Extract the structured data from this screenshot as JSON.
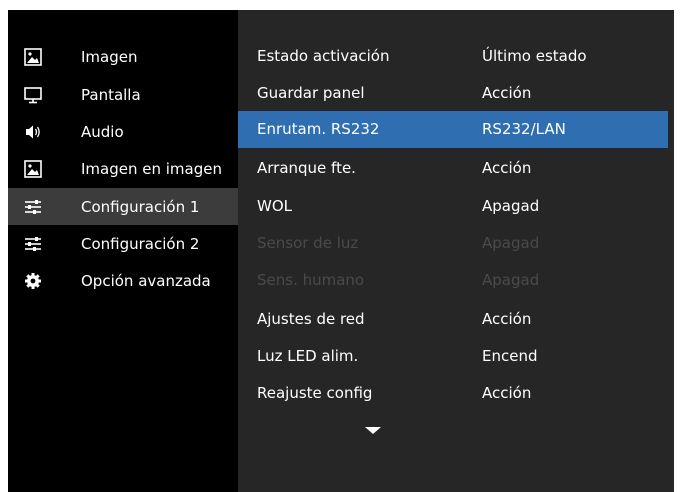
{
  "sidebar": {
    "items": [
      {
        "label": "Imagen",
        "icon": "picture-icon"
      },
      {
        "label": "Pantalla",
        "icon": "monitor-icon"
      },
      {
        "label": "Audio",
        "icon": "speaker-icon"
      },
      {
        "label": "Imagen en imagen",
        "icon": "picture-in-picture-icon"
      },
      {
        "label": "Configuración 1",
        "icon": "sliders-icon"
      },
      {
        "label": "Configuración 2",
        "icon": "sliders-icon"
      },
      {
        "label": "Opción avanzada",
        "icon": "gear-icon"
      }
    ],
    "active_index": 4
  },
  "settings": {
    "rows": [
      {
        "name": "Estado activación",
        "value": "Último estado"
      },
      {
        "name": "Guardar panel",
        "value": "Acción"
      },
      {
        "name": "Enrutam. RS232",
        "value": "RS232/LAN"
      },
      {
        "name": "Arranque fte.",
        "value": "Acción"
      },
      {
        "name": "WOL",
        "value": "Apagad"
      },
      {
        "name": "Sensor de luz",
        "value": "Apagad"
      },
      {
        "name": "Sens. humano",
        "value": "Apagad"
      },
      {
        "name": "Ajustes de red",
        "value": "Acción"
      },
      {
        "name": "Luz LED alim.",
        "value": "Encend"
      },
      {
        "name": "Reajuste config",
        "value": "Acción"
      }
    ],
    "selected_index": 2,
    "disabled_indices": [
      5,
      6
    ],
    "more_indicator": "chevron-down-icon"
  },
  "colors": {
    "highlight": "#2f6fb1",
    "panel": "#262626",
    "active_sidebar": "#3c3c3c",
    "disabled_text": "#4a4a4a"
  }
}
